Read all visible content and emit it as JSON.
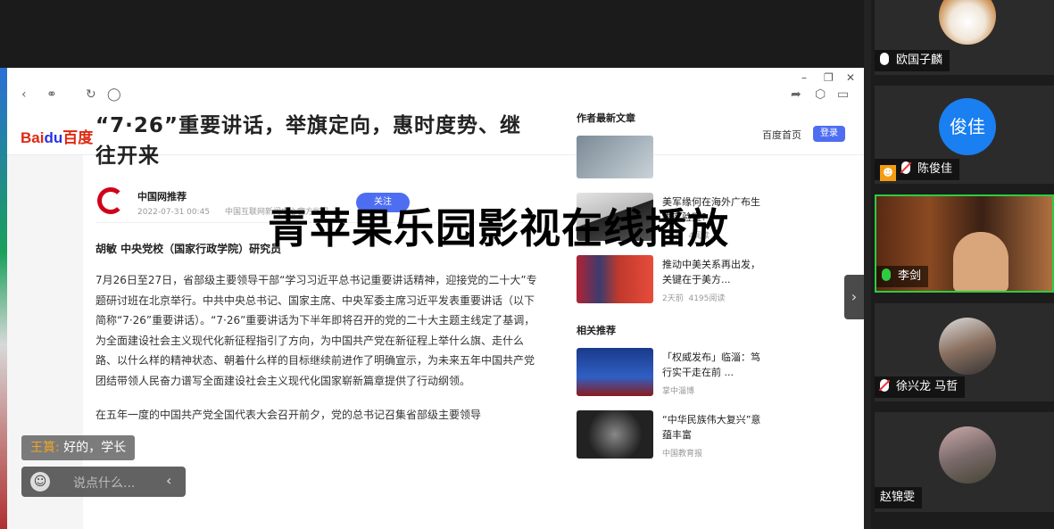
{
  "browser": {
    "window_controls": [
      "–",
      "❐",
      "✕"
    ],
    "toolbar_icons": [
      "back-icon",
      "link-icon",
      "refresh-icon",
      "globe-icon",
      "share-icon",
      "cube-icon",
      "phone-icon"
    ]
  },
  "baidu": {
    "logo_text_bai": "Bai",
    "logo_text_du": "du",
    "logo_text_cn": "百度",
    "home_link": "百度首页",
    "login_button": "登录"
  },
  "article": {
    "title": "“7·26”重要讲话，举旗定向，惠时度势、继往开来",
    "author_name": "中国网推荐",
    "author_date": "2022-07-31 00:45",
    "author_desc": "中国互联网新闻中心官方帐号",
    "follow_button": "关注",
    "byline": "胡敏 中央党校（国家行政学院）研究员",
    "paragraphs": [
      "7月26日至27日，省部级主要领导干部“学习习近平总书记重要讲话精神，迎接党的二十大”专题研讨班在北京举行。中共中央总书记、国家主席、中央军委主席习近平发表重要讲话（以下简称“7·26”重要讲话）。“7·26”重要讲话为下半年即将召开的党的二十大主题主线定了基调，为全面建设社会主义现代化新征程指引了方向，为中国共产党在新征程上举什么旗、走什么路、以什么样的精神状态、朝着什么样的目标继续前进作了明确宣示，为未来五年中国共产党团结带领人民奋力谱写全面建设社会主义现代化国家崭新篇章提供了行动纲领。",
      "在五年一度的中国共产党全国代表大会召开前夕，党的总书记召集省部级主要领导"
    ]
  },
  "sidebar": {
    "latest_heading": "作者最新文章",
    "latest": [
      {
        "title": "美军缘何在海外广布生物实验室?",
        "meta_a": "1天前",
        "meta_b": "4阅读"
      },
      {
        "title": "推动中美关系再出发，关键在于美方...",
        "meta_a": "2天前",
        "meta_b": "4195阅读"
      }
    ],
    "related_heading": "相关推荐",
    "related": [
      {
        "title": "「权威发布」临淄：笃行实干走在前 ...",
        "meta_a": "掌中淄博",
        "meta_b": ""
      },
      {
        "title": "“中华民族伟大复兴”意蕴丰富",
        "meta_a": "中国教育报",
        "meta_b": ""
      }
    ]
  },
  "overlay_title": "青苹果乐园影视在线播放",
  "chat": {
    "user": "王篔:",
    "message": " 好的，学长",
    "placeholder": "说点什么...",
    "emoji_icon": "☺",
    "chevron": "‹"
  },
  "collapse_tab": "›",
  "participants": [
    {
      "name": "欧国子麟",
      "mic": "on"
    },
    {
      "name": "陈俊佳",
      "mic": "off",
      "avatar_text": "俊佳"
    },
    {
      "name": "李剑",
      "mic": "green"
    },
    {
      "name": "徐兴龙 马哲",
      "mic": "off"
    },
    {
      "name": "赵锦雯",
      "mic": "none"
    }
  ],
  "colors": {
    "accent": "#4e6ef2",
    "baidu_red": "#de2910",
    "active_speaker": "#2ecc40",
    "avatar_blue": "#1a7ff0"
  }
}
